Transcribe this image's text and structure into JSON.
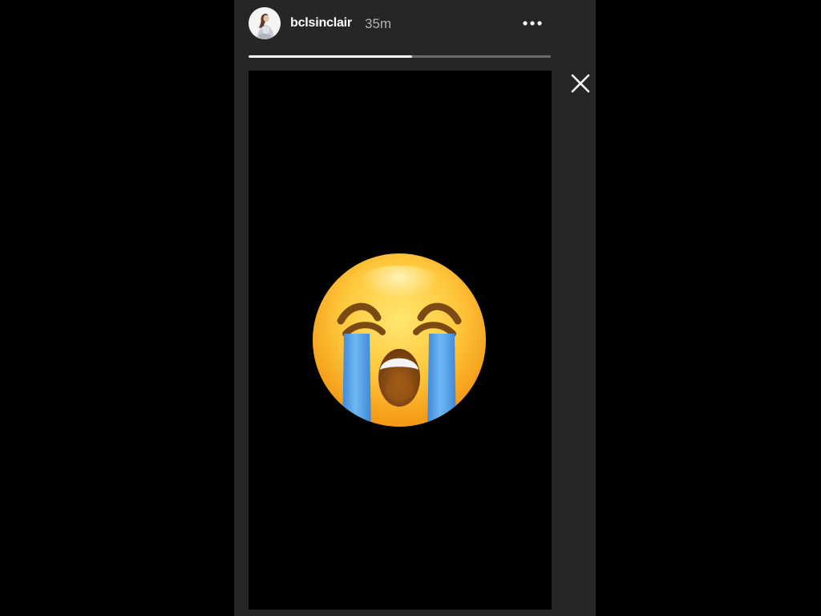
{
  "story": {
    "username": "bclsinclair",
    "timestamp": "35m",
    "progress_fraction": 0.54,
    "media_icon": "loudly-crying-face-emoji"
  },
  "controls": {
    "more_icon": "more-horizontal-icon",
    "close_icon": "close-icon"
  },
  "colors": {
    "background": "#000000",
    "panel": "#262626",
    "progress_track": "#6b6b6b",
    "progress_fill": "#ffffff",
    "emoji_face": "#ffc83d",
    "tears": "#5aa6ea"
  }
}
